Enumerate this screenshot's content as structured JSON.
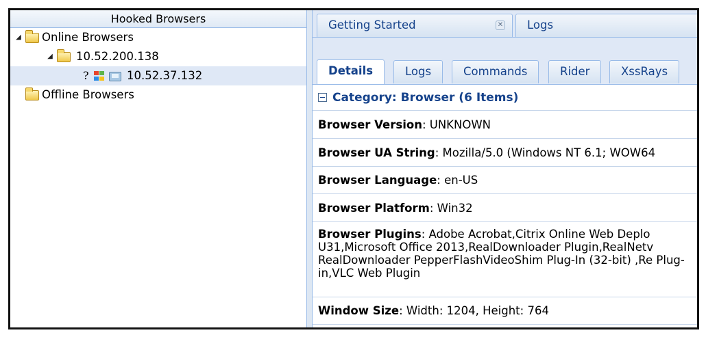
{
  "left_panel": {
    "title": "Hooked Browsers",
    "tree": {
      "online": {
        "label": "Online Browsers",
        "expanded": true
      },
      "host": {
        "label": "10.52.200.138",
        "expanded": true
      },
      "client": {
        "label": "10.52.37.132",
        "icons": [
          "unknown-browser-icon",
          "windows-icon",
          "network-icon"
        ]
      },
      "offline": {
        "label": "Offline Browsers"
      }
    }
  },
  "top_tabs": [
    {
      "label": "Getting Started",
      "closable": true
    },
    {
      "label": "Logs"
    }
  ],
  "sub_tabs": [
    {
      "label": "Details",
      "active": true
    },
    {
      "label": "Logs"
    },
    {
      "label": "Commands"
    },
    {
      "label": "Rider"
    },
    {
      "label": "XssRays"
    }
  ],
  "category": {
    "label": "Category: Browser (6 Items)"
  },
  "details": [
    {
      "key": "Browser Version",
      "value": ": UNKNOWN"
    },
    {
      "key": "Browser UA String",
      "value": ": Mozilla/5.0 (Windows NT 6.1; WOW64"
    },
    {
      "key": "Browser Language",
      "value": ": en-US"
    },
    {
      "key": "Browser Platform",
      "value": ": Win32"
    },
    {
      "key": "Browser Plugins",
      "value": ": Adobe Acrobat,Citrix Online Web Deplo U31,Microsoft Office 2013,RealDownloader Plugin,RealNetv RealDownloader PepperFlashVideoShim Plug-In (32-bit) ,Re Plug-in,VLC Web Plugin"
    },
    {
      "key": "Window Size",
      "value": ": Width: 1204, Height: 764"
    }
  ],
  "colors": {
    "accent": "#15428b",
    "panel_bg": "#dfe8f6",
    "border": "#99bbe8",
    "selected_row": "#dfe8f6"
  }
}
